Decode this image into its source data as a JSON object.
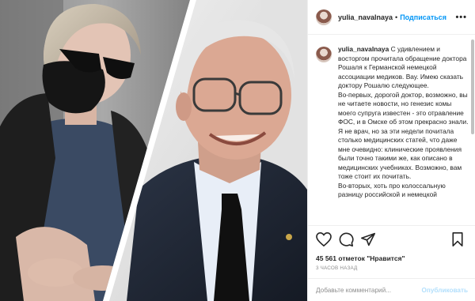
{
  "post": {
    "username": "yulia_navalnaya",
    "separator": "•",
    "follow_label": "Подписаться",
    "more_label": "•••",
    "caption": {
      "username": "yulia_navalnaya",
      "lines": [
        "С удивлением и восторгом прочитала обращение доктора Рошаля к Германской немецкой ассоциации медиков. Вау. Имею сказать доктору Рошалю следующее.",
        "Во-первых, дорогой доктор, возможно, вы не читаете новости, но генезис комы моего супруга известен - это отравление ФОС, и в Омске об этом прекрасно знали. Я не врач, но за эти недели почитала столько медицинских статей, что даже мне очевидно: клинические проявления были точно такими же, как описано в медицинских учебниках. Возможно, вам тоже стоит их почитать.",
        "Во-вторых, хоть про колоссальную разницу российской и немецкой"
      ]
    },
    "likes": "45 561 отметок \"Нравится\"",
    "time_ago": "3 ЧАСОВ НАЗАД",
    "comment": {
      "placeholder": "Добавьте комментарий...",
      "publish_label": "Опубликовать"
    }
  },
  "icons": {
    "like": "heart-icon",
    "comment": "comment-icon",
    "share": "share-icon",
    "save": "bookmark-icon"
  },
  "colors": {
    "follow": "#0095f6",
    "publish_disabled": "#b2dffc",
    "muted": "#8e8e8e"
  }
}
